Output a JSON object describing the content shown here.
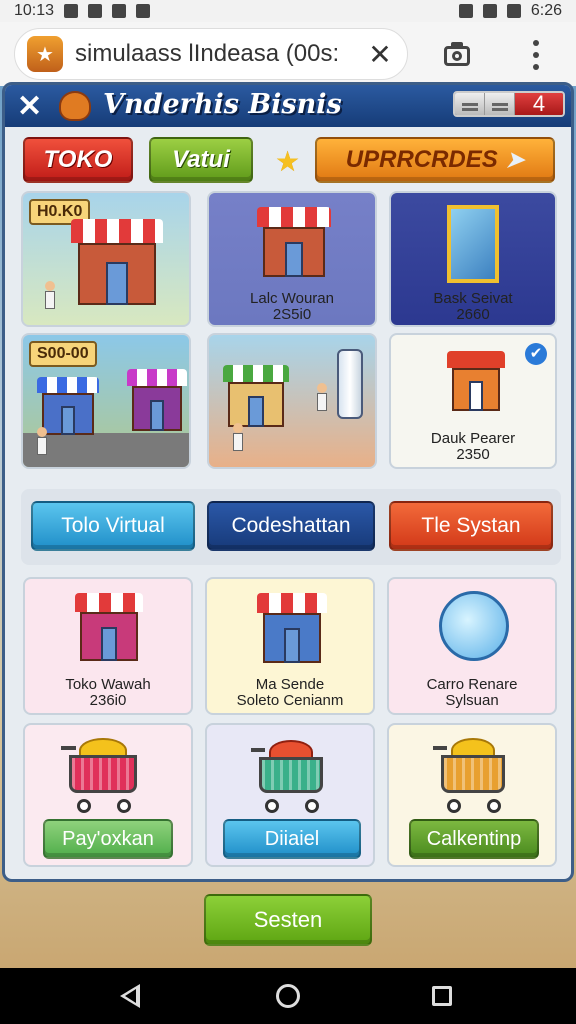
{
  "status_bar": {
    "time": "10:13",
    "right_time": "6:26"
  },
  "browser": {
    "url_text": "simulaass lIndeasa (00s:",
    "close_glyph": "✕"
  },
  "window": {
    "title": "Vnderhis Bisnis",
    "close_glyph": "✕",
    "badge_count": "4"
  },
  "tabs": {
    "toko": "TOKO",
    "vatui": "Vatui",
    "upgrades": "UPRRCRDES"
  },
  "top_cards": [
    {
      "tag": "H0.K0",
      "label": ""
    },
    {
      "label_line1": "Lalc Wouran",
      "label_line2": "2S5i0"
    },
    {
      "label_line1": "Bask Seivat",
      "label_line2": "2660"
    },
    {
      "tag": "S00-00",
      "label": ""
    },
    {
      "label_line1": "",
      "label_line2": ""
    },
    {
      "label_line1": "Dauk Pearer",
      "label_line2": "2350"
    }
  ],
  "mid_buttons": {
    "virtual": "Tolo Virtual",
    "codeshattan": "Codeshattan",
    "system": "Tle Systan"
  },
  "bottom_cards": [
    {
      "label_line1": "Toko Wawah",
      "label_line2": "236i0"
    },
    {
      "label_line1": "Ma Sende",
      "label_line2": "Soleto Cenianm"
    },
    {
      "label_line1": "Carro Renare",
      "label_line2": "Sylsuan"
    },
    {
      "button": "Pay'oxkan"
    },
    {
      "button": "Diiaiel"
    },
    {
      "button": "Calkentinp"
    }
  ],
  "bottom_button": "Sesten",
  "colors": {
    "title_bar": "#163c78",
    "red_button": "#c01c18",
    "green_button": "#5f9a1a",
    "orange_button": "#e07812",
    "cyan_button": "#1f8ec8",
    "navy_button": "#173a7a"
  }
}
